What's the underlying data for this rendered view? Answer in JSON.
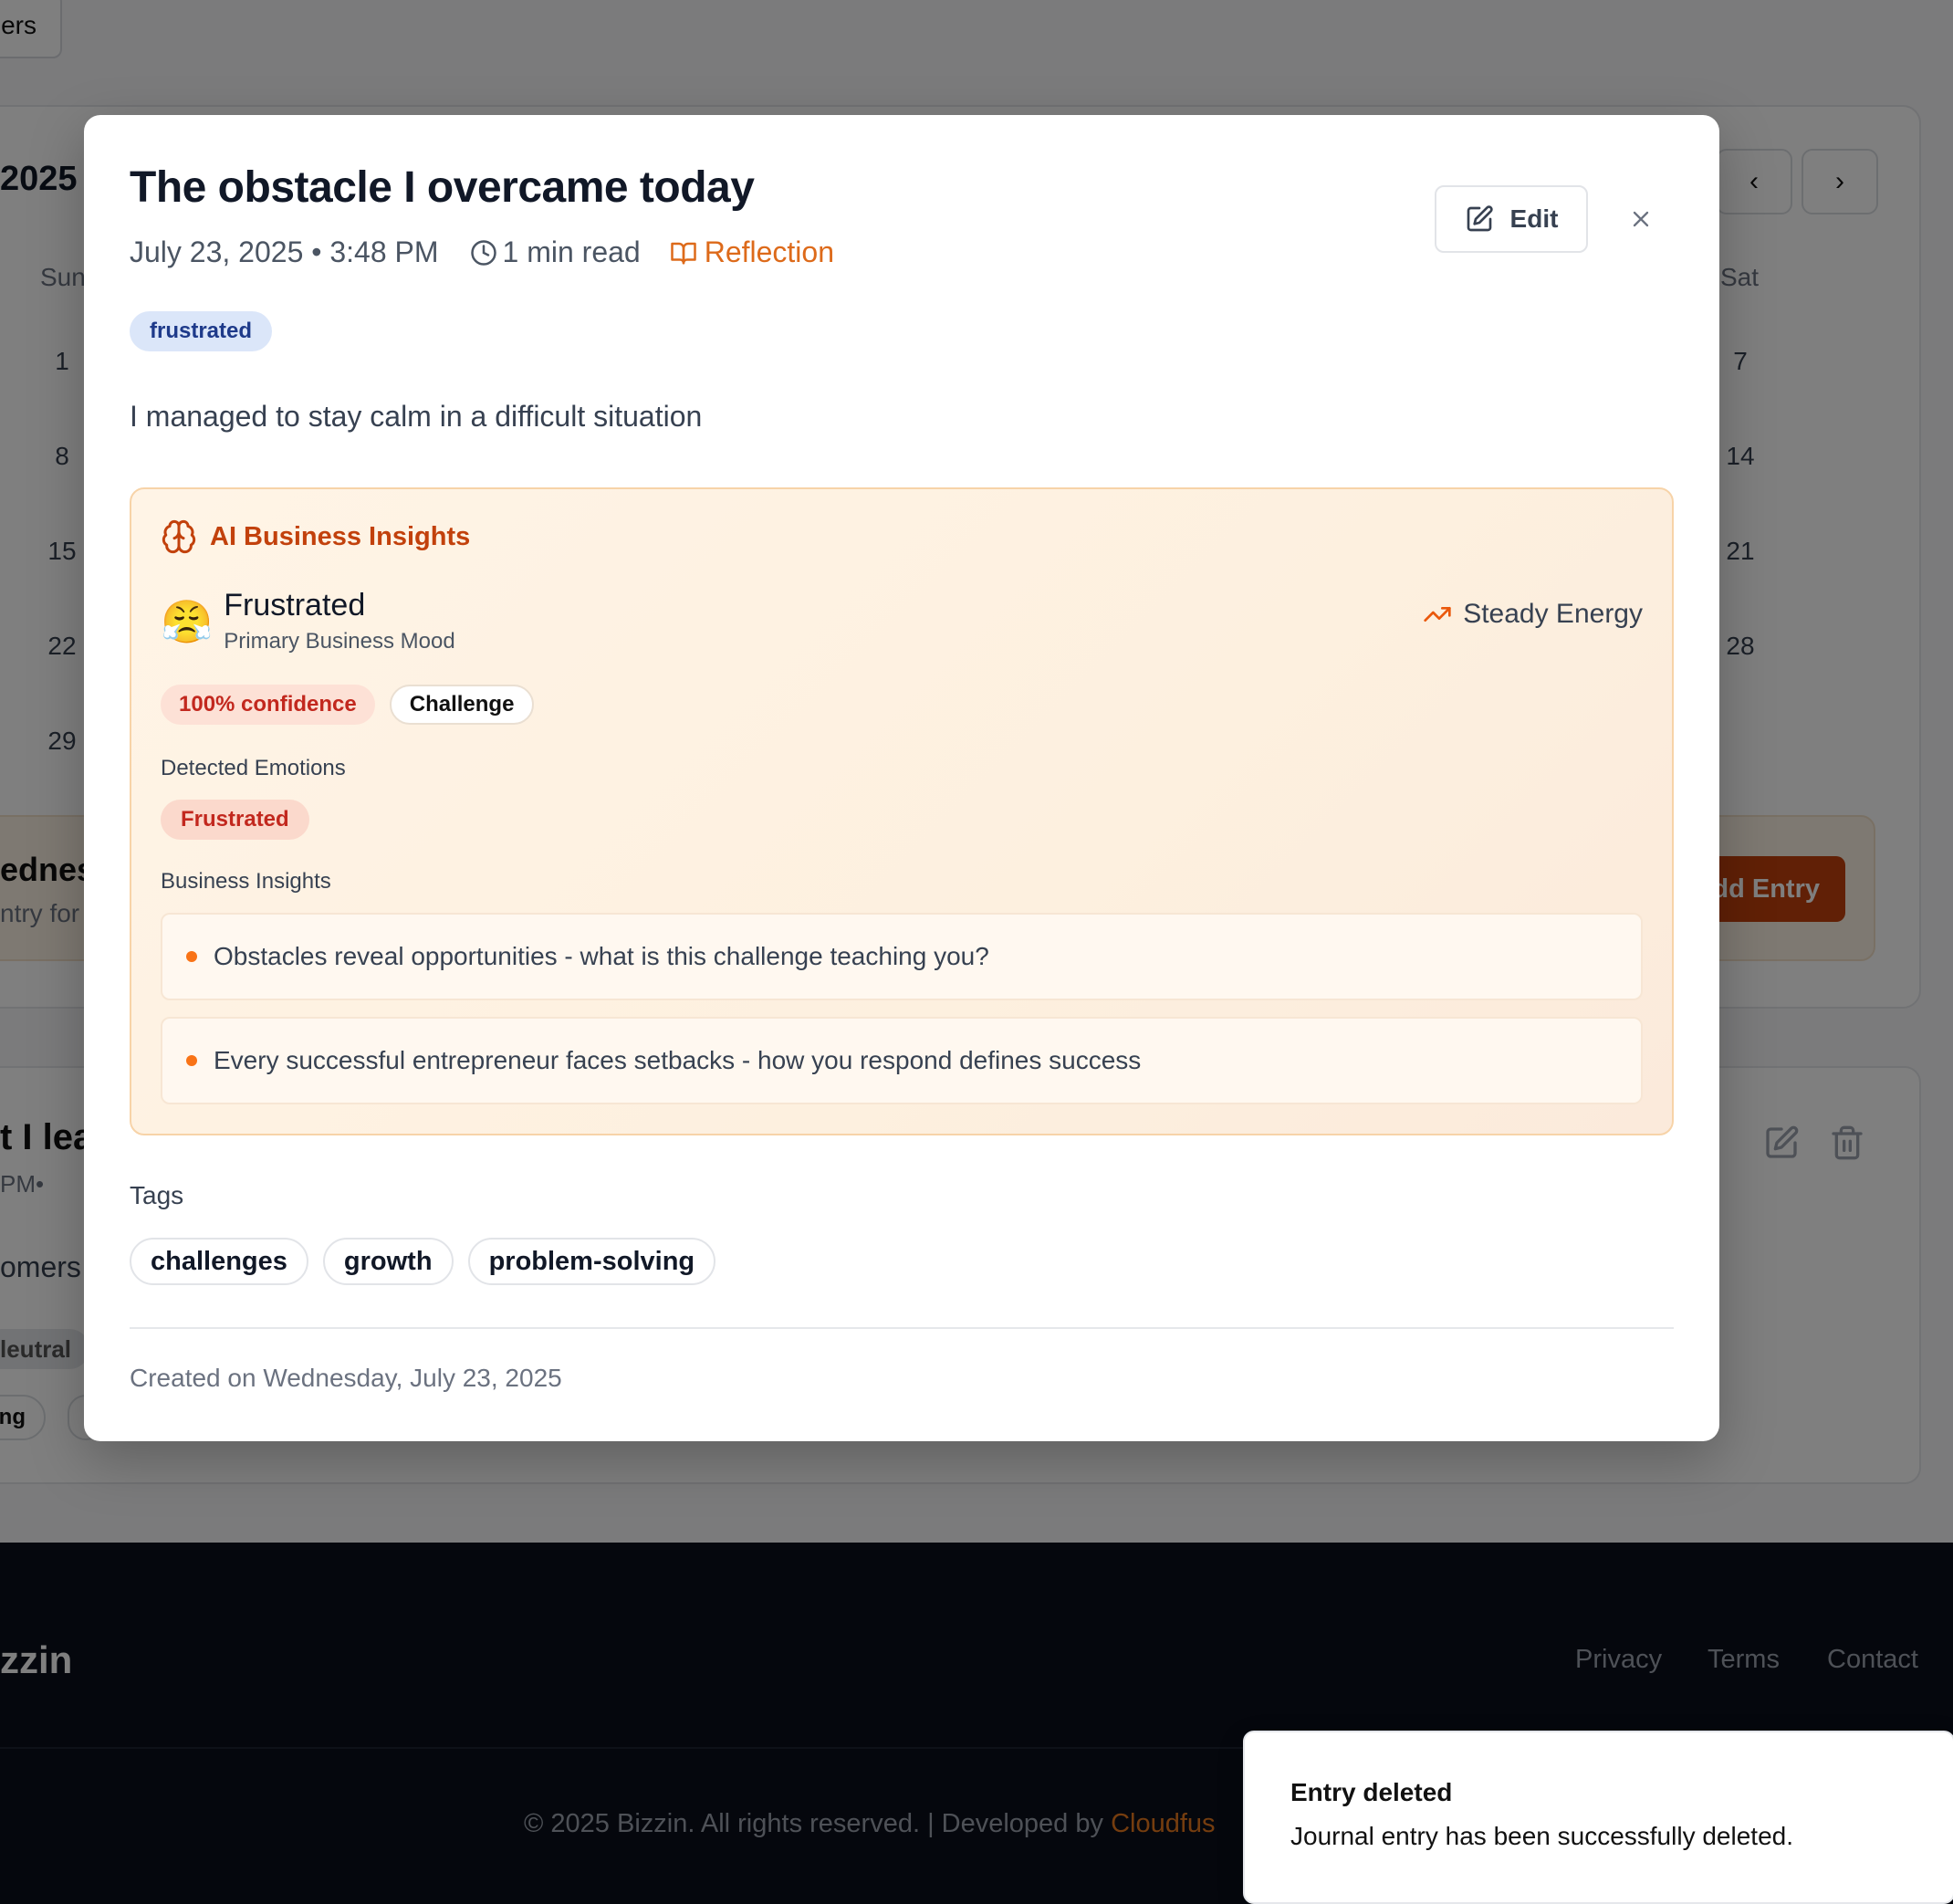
{
  "background": {
    "filter_button_label": "ers",
    "calendar": {
      "month_title": "2025",
      "prev_label": "‹",
      "next_label": "›",
      "dow_left": "Sun",
      "dow_right": "Sat",
      "left_column": [
        "1",
        "8",
        "15",
        "22",
        "29"
      ],
      "right_column": [
        "7",
        "14",
        "21",
        "28"
      ]
    },
    "day_panel": {
      "title": "ednes",
      "subtitle": "ntry for",
      "add_entry_label": "dd Entry"
    },
    "entry_card": {
      "title": "t I lea",
      "meta": "PM•",
      "text": "omers",
      "mood": "leutral",
      "tag": "ing"
    },
    "footer": {
      "brand": "zzin",
      "links": [
        "Privacy",
        "Terms",
        "Contact"
      ],
      "copyright": "© 2025 Bizzin. All rights reserved. | Developed by ",
      "developer": "Cloudfus"
    }
  },
  "modal": {
    "title": "The obstacle I overcame today",
    "date": "July 23, 2025 • 3:48 PM",
    "read_time": "1 min read",
    "category": "Reflection",
    "edit_label": "Edit",
    "mood_chip": "frustrated",
    "body": "I managed to stay calm in a difficult situation",
    "ai_insights": {
      "heading": "AI Business Insights",
      "emoji": "😤",
      "primary_mood": "Frustrated",
      "primary_mood_label": "Primary Business Mood",
      "energy": "Steady Energy",
      "confidence": "100% confidence",
      "type": "Challenge",
      "detected_emotions_label": "Detected Emotions",
      "emotions": [
        "Frustrated"
      ],
      "business_insights_label": "Business Insights",
      "insights": [
        "Obstacles reveal opportunities - what is this challenge teaching you?",
        "Every successful entrepreneur faces setbacks - how you respond defines success"
      ]
    },
    "tags_label": "Tags",
    "tags": [
      "challenges",
      "growth",
      "problem-solving"
    ],
    "created": "Created on Wednesday, July 23, 2025"
  },
  "toast": {
    "title": "Entry deleted",
    "description": "Journal entry has been successfully deleted."
  },
  "colors": {
    "accent": "#c2410c",
    "category": "#dd6a1a",
    "mood_chip_bg": "#dbe6f9",
    "footer_bg": "#0b0f1a"
  }
}
